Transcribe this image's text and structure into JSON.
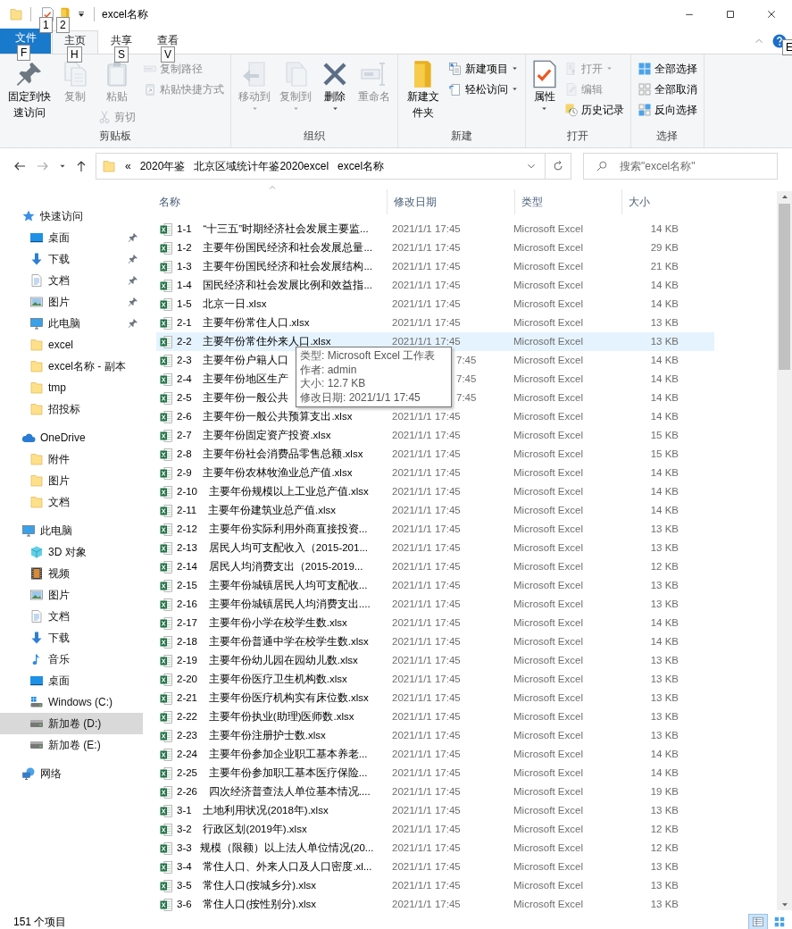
{
  "window": {
    "title": "excel名称",
    "quick_access": [
      {
        "kind": "properties",
        "keytip": "1"
      },
      {
        "kind": "new-folder",
        "keytip": "2"
      }
    ]
  },
  "ribbon": {
    "tabs": [
      {
        "label": "文件",
        "kind": "file",
        "keytip": "F",
        "selected": false
      },
      {
        "label": "主页",
        "kind": "tab",
        "keytip": "H",
        "selected": true
      },
      {
        "label": "共享",
        "kind": "tab",
        "keytip": "S",
        "selected": false
      },
      {
        "label": "查看",
        "kind": "tab",
        "keytip": "V",
        "selected": false
      }
    ],
    "help_keytip": "E",
    "groups": [
      {
        "label": "剪贴板",
        "columns": [
          [
            {
              "label": "固定到快速访问",
              "kind": "large",
              "disabled": false,
              "dropdown": false
            }
          ],
          [
            {
              "label": "复制",
              "kind": "large",
              "disabled": true,
              "dropdown": false
            }
          ],
          [
            {
              "label": "粘贴",
              "kind": "large",
              "disabled": true,
              "dropdown": false
            },
            {
              "label": "剪切",
              "kind": "small",
              "disabled": true,
              "dropdown": false
            }
          ],
          [
            {
              "label": "复制路径",
              "kind": "small",
              "disabled": true,
              "dropdown": false
            },
            {
              "label": "粘贴快捷方式",
              "kind": "small",
              "disabled": true,
              "dropdown": false
            }
          ]
        ]
      },
      {
        "label": "组织",
        "columns": [
          [
            {
              "label": "移动到",
              "kind": "large",
              "disabled": true,
              "dropdown": true
            }
          ],
          [
            {
              "label": "复制到",
              "kind": "large",
              "disabled": true,
              "dropdown": true
            }
          ],
          [
            {
              "label": "删除",
              "kind": "large",
              "disabled": false,
              "dropdown": true
            }
          ],
          [
            {
              "label": "重命名",
              "kind": "large",
              "disabled": true,
              "dropdown": false
            }
          ]
        ]
      },
      {
        "label": "新建",
        "columns": [
          [
            {
              "label": "新建文件夹",
              "kind": "large",
              "disabled": false,
              "dropdown": false
            }
          ],
          [
            {
              "label": "新建项目",
              "kind": "small",
              "disabled": false,
              "dropdown": true
            },
            {
              "label": "轻松访问",
              "kind": "small",
              "disabled": false,
              "dropdown": true
            }
          ]
        ]
      },
      {
        "label": "打开",
        "columns": [
          [
            {
              "label": "属性",
              "kind": "large",
              "disabled": false,
              "dropdown": true
            }
          ],
          [
            {
              "label": "打开",
              "kind": "small",
              "disabled": true,
              "dropdown": true
            },
            {
              "label": "编辑",
              "kind": "small",
              "disabled": true,
              "dropdown": false
            },
            {
              "label": "历史记录",
              "kind": "small",
              "disabled": false,
              "dropdown": false
            }
          ]
        ]
      },
      {
        "label": "选择",
        "columns": [
          [
            {
              "label": "全部选择",
              "kind": "small",
              "disabled": false,
              "dropdown": false
            },
            {
              "label": "全部取消",
              "kind": "small",
              "disabled": false,
              "dropdown": false
            },
            {
              "label": "反向选择",
              "kind": "small",
              "disabled": false,
              "dropdown": false
            }
          ]
        ]
      }
    ]
  },
  "address_bar": {
    "overflow": "«",
    "crumbs": [
      "2020年鉴",
      "北京区域统计年鉴2020excel",
      "excel名称"
    ],
    "search_placeholder": "搜索\"excel名称\""
  },
  "sidebar": {
    "items": [
      {
        "label": "快速访问",
        "kind": "star",
        "selected": false,
        "children": [
          {
            "label": "桌面",
            "kind": "desktop",
            "selected": false,
            "pinned": true
          },
          {
            "label": "下载",
            "kind": "download",
            "selected": false,
            "pinned": true
          },
          {
            "label": "文档",
            "kind": "document",
            "selected": false,
            "pinned": true
          },
          {
            "label": "图片",
            "kind": "pictures",
            "selected": false,
            "pinned": true
          },
          {
            "label": "此电脑",
            "kind": "computer",
            "selected": false,
            "pinned": true
          },
          {
            "label": "excel",
            "kind": "folder",
            "selected": false,
            "pinned": false
          },
          {
            "label": "excel名称 - 副本",
            "kind": "folder",
            "selected": false,
            "pinned": false
          },
          {
            "label": "tmp",
            "kind": "folder",
            "selected": false,
            "pinned": false
          },
          {
            "label": "招投标",
            "kind": "folder",
            "selected": false,
            "pinned": false
          }
        ]
      },
      {
        "label": "OneDrive",
        "kind": "cloud",
        "selected": false,
        "children": [
          {
            "label": "附件",
            "kind": "folder",
            "selected": false
          },
          {
            "label": "图片",
            "kind": "folder",
            "selected": false
          },
          {
            "label": "文档",
            "kind": "folder",
            "selected": false
          }
        ]
      },
      {
        "label": "此电脑",
        "kind": "computer",
        "selected": false,
        "children": [
          {
            "label": "3D 对象",
            "kind": "cube",
            "selected": false
          },
          {
            "label": "视频",
            "kind": "video",
            "selected": false
          },
          {
            "label": "图片",
            "kind": "pictures",
            "selected": false
          },
          {
            "label": "文档",
            "kind": "document",
            "selected": false
          },
          {
            "label": "下载",
            "kind": "download",
            "selected": false
          },
          {
            "label": "音乐",
            "kind": "music",
            "selected": false
          },
          {
            "label": "桌面",
            "kind": "desktop",
            "selected": false
          },
          {
            "label": "Windows (C:)",
            "kind": "drive-windows",
            "selected": false
          },
          {
            "label": "新加卷 (D:)",
            "kind": "drive",
            "selected": true
          },
          {
            "label": "新加卷 (E:)",
            "kind": "drive",
            "selected": false
          }
        ]
      },
      {
        "label": "网络",
        "kind": "network",
        "selected": false
      }
    ]
  },
  "file_list": {
    "columns": [
      {
        "label": "名称",
        "sorted": true
      },
      {
        "label": "修改日期",
        "sorted": false
      },
      {
        "label": "类型",
        "sorted": false
      },
      {
        "label": "大小",
        "sorted": false
      }
    ],
    "rows": [
      {
        "name": "1-1    “十三五”时期经济社会发展主要监...",
        "date": "2021/1/1 17:45",
        "type": "Microsoft Excel",
        "size": "14 KB",
        "hovered": false,
        "covered": false
      },
      {
        "name": "1-2    主要年份国民经济和社会发展总量...",
        "date": "2021/1/1 17:45",
        "type": "Microsoft Excel",
        "size": "29 KB",
        "hovered": false,
        "covered": false
      },
      {
        "name": "1-3    主要年份国民经济和社会发展结构...",
        "date": "2021/1/1 17:45",
        "type": "Microsoft Excel",
        "size": "21 KB",
        "hovered": false,
        "covered": false
      },
      {
        "name": "1-4    国民经济和社会发展比例和效益指...",
        "date": "2021/1/1 17:45",
        "type": "Microsoft Excel",
        "size": "14 KB",
        "hovered": false,
        "covered": false
      },
      {
        "name": "1-5    北京一日.xlsx",
        "date": "2021/1/1 17:45",
        "type": "Microsoft Excel",
        "size": "14 KB",
        "hovered": false,
        "covered": false
      },
      {
        "name": "2-1    主要年份常住人口.xlsx",
        "date": "2021/1/1 17:45",
        "type": "Microsoft Excel",
        "size": "13 KB",
        "hovered": false,
        "covered": false
      },
      {
        "name": "2-2    主要年份常住外来人口.xlsx",
        "date": "2021/1/1 17:45",
        "type": "Microsoft Excel",
        "size": "13 KB",
        "hovered": true,
        "covered": false
      },
      {
        "name": "2-3    主要年份户籍人口",
        "date": "7:45",
        "type": "Microsoft Excel",
        "size": "14 KB",
        "hovered": false,
        "covered": true
      },
      {
        "name": "2-4    主要年份地区生产",
        "date": "7:45",
        "type": "Microsoft Excel",
        "size": "14 KB",
        "hovered": false,
        "covered": true
      },
      {
        "name": "2-5    主要年份一般公共",
        "date": "7:45",
        "type": "Microsoft Excel",
        "size": "14 KB",
        "hovered": false,
        "covered": true
      },
      {
        "name": "2-6    主要年份一般公共预算支出.xlsx",
        "date": "2021/1/1 17:45",
        "type": "Microsoft Excel",
        "size": "14 KB",
        "hovered": false,
        "covered": false
      },
      {
        "name": "2-7    主要年份固定资产投资.xlsx",
        "date": "2021/1/1 17:45",
        "type": "Microsoft Excel",
        "size": "15 KB",
        "hovered": false,
        "covered": false
      },
      {
        "name": "2-8    主要年份社会消费品零售总额.xlsx",
        "date": "2021/1/1 17:45",
        "type": "Microsoft Excel",
        "size": "15 KB",
        "hovered": false,
        "covered": false
      },
      {
        "name": "2-9    主要年份农林牧渔业总产值.xlsx",
        "date": "2021/1/1 17:45",
        "type": "Microsoft Excel",
        "size": "14 KB",
        "hovered": false,
        "covered": false
      },
      {
        "name": "2-10    主要年份规模以上工业总产值.xlsx",
        "date": "2021/1/1 17:45",
        "type": "Microsoft Excel",
        "size": "14 KB",
        "hovered": false,
        "covered": false
      },
      {
        "name": "2-11    主要年份建筑业总产值.xlsx",
        "date": "2021/1/1 17:45",
        "type": "Microsoft Excel",
        "size": "14 KB",
        "hovered": false,
        "covered": false
      },
      {
        "name": "2-12    主要年份实际利用外商直接投资...",
        "date": "2021/1/1 17:45",
        "type": "Microsoft Excel",
        "size": "13 KB",
        "hovered": false,
        "covered": false
      },
      {
        "name": "2-13    居民人均可支配收入（2015-201...",
        "date": "2021/1/1 17:45",
        "type": "Microsoft Excel",
        "size": "13 KB",
        "hovered": false,
        "covered": false
      },
      {
        "name": "2-14    居民人均消费支出（2015-2019...",
        "date": "2021/1/1 17:45",
        "type": "Microsoft Excel",
        "size": "12 KB",
        "hovered": false,
        "covered": false
      },
      {
        "name": "2-15    主要年份城镇居民人均可支配收...",
        "date": "2021/1/1 17:45",
        "type": "Microsoft Excel",
        "size": "13 KB",
        "hovered": false,
        "covered": false
      },
      {
        "name": "2-16    主要年份城镇居民人均消费支出....",
        "date": "2021/1/1 17:45",
        "type": "Microsoft Excel",
        "size": "13 KB",
        "hovered": false,
        "covered": false
      },
      {
        "name": "2-17    主要年份小学在校学生数.xlsx",
        "date": "2021/1/1 17:45",
        "type": "Microsoft Excel",
        "size": "14 KB",
        "hovered": false,
        "covered": false
      },
      {
        "name": "2-18    主要年份普通中学在校学生数.xlsx",
        "date": "2021/1/1 17:45",
        "type": "Microsoft Excel",
        "size": "14 KB",
        "hovered": false,
        "covered": false
      },
      {
        "name": "2-19    主要年份幼儿园在园幼儿数.xlsx",
        "date": "2021/1/1 17:45",
        "type": "Microsoft Excel",
        "size": "13 KB",
        "hovered": false,
        "covered": false
      },
      {
        "name": "2-20    主要年份医疗卫生机构数.xlsx",
        "date": "2021/1/1 17:45",
        "type": "Microsoft Excel",
        "size": "13 KB",
        "hovered": false,
        "covered": false
      },
      {
        "name": "2-21    主要年份医疗机构实有床位数.xlsx",
        "date": "2021/1/1 17:45",
        "type": "Microsoft Excel",
        "size": "13 KB",
        "hovered": false,
        "covered": false
      },
      {
        "name": "2-22    主要年份执业(助理)医师数.xlsx",
        "date": "2021/1/1 17:45",
        "type": "Microsoft Excel",
        "size": "13 KB",
        "hovered": false,
        "covered": false
      },
      {
        "name": "2-23    主要年份注册护士数.xlsx",
        "date": "2021/1/1 17:45",
        "type": "Microsoft Excel",
        "size": "13 KB",
        "hovered": false,
        "covered": false
      },
      {
        "name": "2-24    主要年份参加企业职工基本养老...",
        "date": "2021/1/1 17:45",
        "type": "Microsoft Excel",
        "size": "14 KB",
        "hovered": false,
        "covered": false
      },
      {
        "name": "2-25    主要年份参加职工基本医疗保险...",
        "date": "2021/1/1 17:45",
        "type": "Microsoft Excel",
        "size": "14 KB",
        "hovered": false,
        "covered": false
      },
      {
        "name": "2-26    四次经济普查法人单位基本情况....",
        "date": "2021/1/1 17:45",
        "type": "Microsoft Excel",
        "size": "19 KB",
        "hovered": false,
        "covered": false
      },
      {
        "name": "3-1    土地利用状况(2018年).xlsx",
        "date": "2021/1/1 17:45",
        "type": "Microsoft Excel",
        "size": "13 KB",
        "hovered": false,
        "covered": false
      },
      {
        "name": "3-2    行政区划(2019年).xlsx",
        "date": "2021/1/1 17:45",
        "type": "Microsoft Excel",
        "size": "12 KB",
        "hovered": false,
        "covered": false
      },
      {
        "name": "3-3   规模（限额）以上法人单位情况(20...",
        "date": "2021/1/1 17:45",
        "type": "Microsoft Excel",
        "size": "12 KB",
        "hovered": false,
        "covered": false
      },
      {
        "name": "3-4    常住人口、外来人口及人口密度.xl...",
        "date": "2021/1/1 17:45",
        "type": "Microsoft Excel",
        "size": "13 KB",
        "hovered": false,
        "covered": false
      },
      {
        "name": "3-5    常住人口(按城乡分).xlsx",
        "date": "2021/1/1 17:45",
        "type": "Microsoft Excel",
        "size": "13 KB",
        "hovered": false,
        "covered": false
      },
      {
        "name": "3-6    常住人口(按性别分).xlsx",
        "date": "2021/1/1 17:45",
        "type": "Microsoft Excel",
        "size": "13 KB",
        "hovered": false,
        "covered": false
      }
    ],
    "tooltip": {
      "lines": [
        "类型: Microsoft Excel 工作表",
        "作者: admin",
        "大小: 12.7 KB",
        "修改日期: 2021/1/1 17:45"
      ]
    }
  },
  "status_bar": {
    "item_count": "151 个项目",
    "views": [
      {
        "kind": "details",
        "selected": true
      },
      {
        "kind": "tiles",
        "selected": false
      }
    ]
  }
}
